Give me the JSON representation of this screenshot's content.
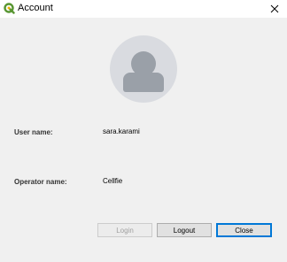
{
  "window": {
    "title": "Account"
  },
  "icons": {
    "app": "qgis-logo-icon",
    "close": "close-icon",
    "avatar": "user-avatar-icon"
  },
  "fields": {
    "user_name_label": "User name:",
    "user_name_value": "sara.karami",
    "operator_name_label": "Operator name:",
    "operator_name_value": "Cellfie"
  },
  "buttons": {
    "login": "Login",
    "logout": "Logout",
    "close": "Close"
  },
  "colors": {
    "brand_green": "#589632",
    "default_button_border": "#0078d7"
  }
}
